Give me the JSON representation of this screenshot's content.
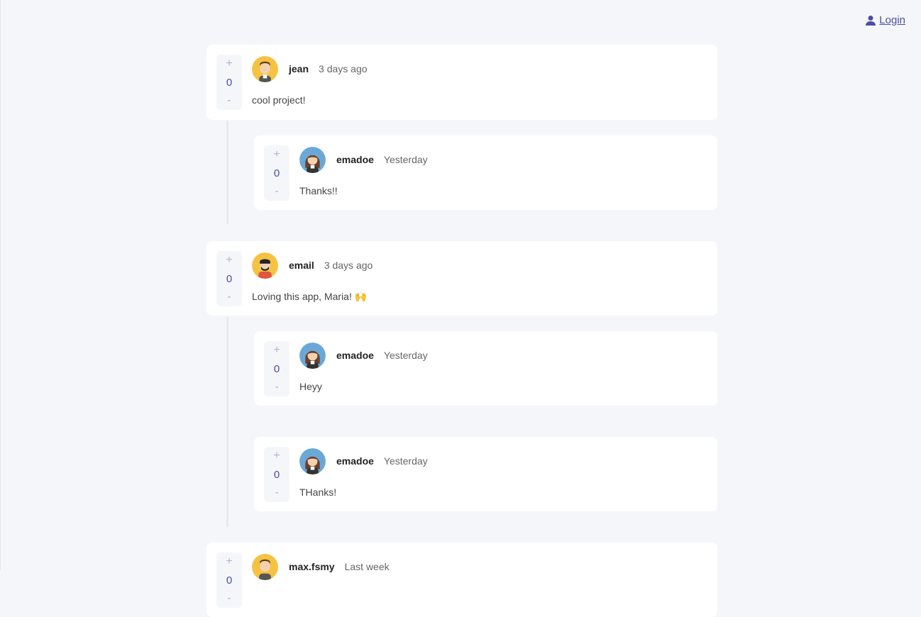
{
  "header": {
    "login_label": "Login"
  },
  "comments": [
    {
      "username": "jean",
      "time": "3 days ago",
      "text": "cool project!",
      "score": "0"
    },
    {
      "username": "emadoe",
      "time": "Yesterday",
      "text": "Thanks!!",
      "score": "0"
    },
    {
      "username": "email",
      "time": "3 days ago",
      "text": "Loving this app, Maria! 🙌",
      "score": "0"
    },
    {
      "username": "emadoe",
      "time": "Yesterday",
      "text": "Heyy",
      "score": "0"
    },
    {
      "username": "emadoe",
      "time": "Yesterday",
      "text": "THanks!",
      "score": "0"
    },
    {
      "username": "max.fsmy",
      "time": "Last week",
      "text": "",
      "score": "0"
    }
  ],
  "vote": {
    "up": "+",
    "down": "-"
  },
  "icons": {
    "login": "user-icon",
    "avatar_jean": "male-avatar",
    "avatar_email": "bearded-man-avatar",
    "avatar_emadoe": "female-avatar"
  },
  "colors": {
    "accent": "#4a4ea6",
    "background": "#f5f6fa",
    "avatar_yellow": "#f5c242",
    "avatar_blue": "#6aa8d8"
  }
}
